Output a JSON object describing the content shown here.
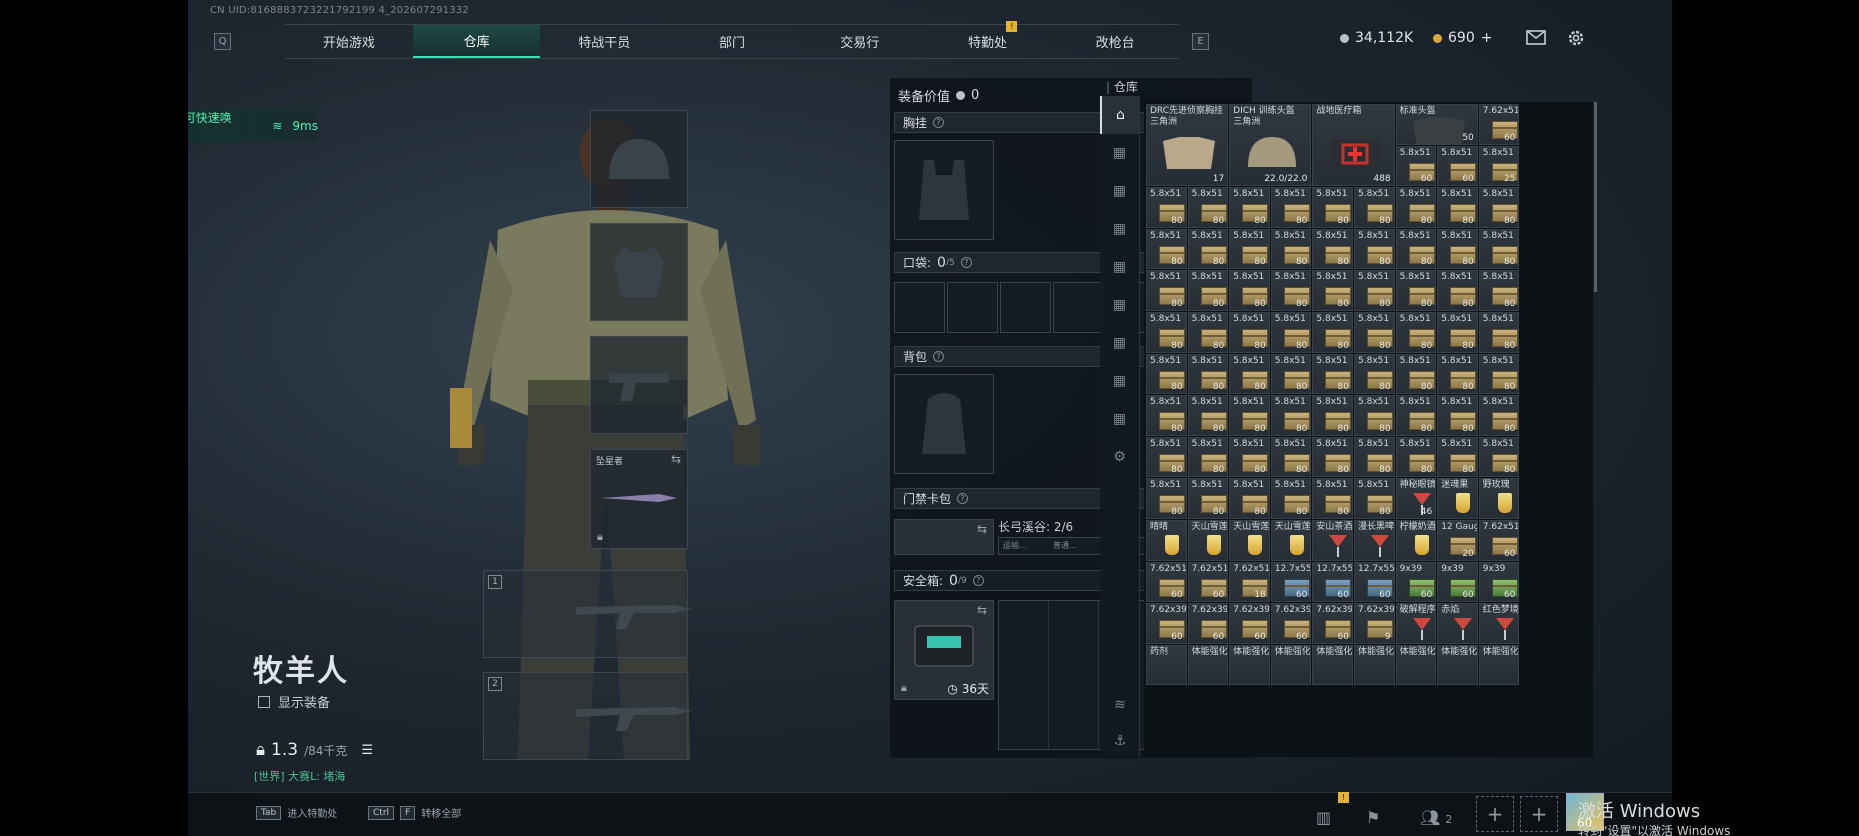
{
  "uid": "CN UID:8168883723221792199 4_202607291332",
  "nav": {
    "left_key": "Q",
    "right_key": "E",
    "tabs": [
      "开始游戏",
      "仓库",
      "特战干员",
      "部门",
      "交易行",
      "特勤处",
      "改枪台"
    ],
    "active_index": 1,
    "badge": "!"
  },
  "currency": {
    "silver": "34,112K",
    "gold": "690",
    "plus": "+"
  },
  "menu_banner": {
    "text": "菜单栏在这里（Shift+Tab可快速唤起）",
    "ping": "9ms"
  },
  "operator": {
    "name": "牧羊人",
    "show_equipment": "显示装备",
    "weight": "1.3",
    "weight_max": "/84千克",
    "map": "[世界] 大赛L: 堵海"
  },
  "gear_slots": {
    "melee_label": "坠星者",
    "weapon1": "1",
    "weapon2": "2"
  },
  "loadout": {
    "equip_value_label": "装备价值",
    "equip_value": "0",
    "chest_rig": "胸挂",
    "pockets": "口袋:",
    "pockets_count": "0",
    "pockets_max": "/5",
    "backpack": "背包",
    "keycard": "门禁卡包",
    "keycard_info": "长弓溪谷: 2/6",
    "keycard_sub1": "运输...",
    "keycard_sub2": "普通...",
    "safebox": "安全箱:",
    "safebox_count": "0",
    "safebox_max": "/9",
    "safebox_timer": "36天",
    "q": "?"
  },
  "warehouse": {
    "label": "仓库",
    "big_items": [
      {
        "name": "DRC先进侦察胸挂\n三角洲",
        "qty": "17"
      },
      {
        "name": "DICH 训练头盔\n三角洲",
        "qty": "22.0/22.0"
      },
      {
        "name": "战地医疗箱",
        "qty": "488"
      },
      {
        "name": "标准头盔",
        "qty": "50"
      }
    ],
    "ammo_label": "5.8x51",
    "ammo_qty": "80",
    "row9": [
      {
        "name": "5.8x51",
        "qty": "80"
      },
      {
        "name": "5.8x51",
        "qty": "80"
      },
      {
        "name": "5.8x51",
        "qty": "80"
      },
      {
        "name": "5.8x51",
        "qty": "80"
      },
      {
        "name": "5.8x51",
        "qty": "80"
      },
      {
        "name": "5.8x51",
        "qty": "80"
      },
      {
        "name": "神秘眼镜",
        "qty": "46"
      },
      {
        "name": "迷魂果",
        "qty": ""
      },
      {
        "name": "野玫瑰",
        "qty": ""
      }
    ],
    "row10": [
      {
        "name": "晴晴",
        "qty": ""
      },
      {
        "name": "天山雪莲",
        "qty": ""
      },
      {
        "name": "天山雪莲",
        "qty": ""
      },
      {
        "name": "天山雪莲",
        "qty": ""
      },
      {
        "name": "安山茶酒",
        "qty": ""
      },
      {
        "name": "漫长黑啤",
        "qty": ""
      },
      {
        "name": "柠檬奶酒",
        "qty": ""
      },
      {
        "name": "12 Gauge",
        "qty": "20"
      },
      {
        "name": "7.62x51",
        "qty": "60"
      }
    ],
    "row11": [
      {
        "name": "7.62x51",
        "qty": "60"
      },
      {
        "name": "7.62x51",
        "qty": "60"
      },
      {
        "name": "7.62x51",
        "qty": "18"
      },
      {
        "name": "12.7x55",
        "qty": "60"
      },
      {
        "name": "12.7x55",
        "qty": "60"
      },
      {
        "name": "12.7x55",
        "qty": "60"
      },
      {
        "name": "9x39",
        "qty": "60"
      },
      {
        "name": "9x39",
        "qty": "60"
      },
      {
        "name": "9x39",
        "qty": "60"
      }
    ],
    "row12": [
      {
        "name": "7.62x39",
        "qty": "60"
      },
      {
        "name": "7.62x39",
        "qty": "60"
      },
      {
        "name": "7.62x39",
        "qty": "60"
      },
      {
        "name": "7.62x39",
        "qty": "60"
      },
      {
        "name": "7.62x39",
        "qty": "60"
      },
      {
        "name": "7.62x39",
        "qty": "9"
      },
      {
        "name": "破解程序",
        "qty": ""
      },
      {
        "name": "赤焰",
        "qty": ""
      },
      {
        "name": "红色梦境",
        "qty": ""
      }
    ],
    "row13": [
      {
        "name": "药剂"
      },
      {
        "name": "体能强化剂"
      },
      {
        "name": "体能强化剂"
      },
      {
        "name": "体能强化剂"
      },
      {
        "name": "体能强化剂"
      },
      {
        "name": "体能强化剂"
      },
      {
        "name": "体能强化剂"
      },
      {
        "name": "体能强化剂"
      },
      {
        "name": "体能强化剂"
      }
    ],
    "right_col": [
      {
        "name": "7.62x51",
        "qty": "60"
      },
      {
        "name": "5.8x51",
        "qty": "25"
      }
    ],
    "row1_extra": [
      {
        "name": "5.8x51",
        "qty": "60"
      },
      {
        "name": "5.8x51",
        "qty": "60"
      },
      {
        "name": "5.8x51",
        "qty": "25"
      }
    ]
  },
  "bottom": {
    "hint1_key": "Tab",
    "hint1": "进入特勤处",
    "hint2_key": "Ctrl",
    "hint2_key2": "F",
    "hint2": "转移全部",
    "squad_count": "2",
    "badge": "!",
    "avatar_level": "60",
    "watermark1": "激活 Windows",
    "watermark2": "转到\"设置\"以激活 Windows"
  },
  "colors": {
    "accent": "#3de0b5",
    "banner_text": "#4ef0b2",
    "badge": "#e3b331",
    "map_text": "#4fbf8d"
  }
}
